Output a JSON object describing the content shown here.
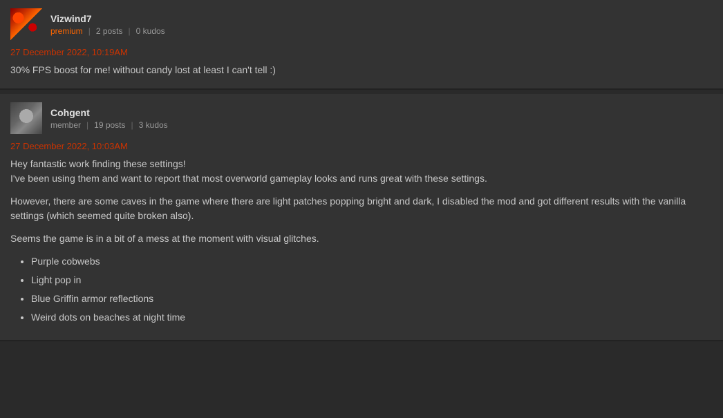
{
  "posts": [
    {
      "id": "post-1",
      "username": "Vizwind7",
      "badge": "premium",
      "badge_type": "premium",
      "posts_count": "2 posts",
      "kudos_count": "0 kudos",
      "timestamp": "27 December 2022, 10:19AM",
      "paragraphs": [
        "30% FPS boost for me! without candy lost at least I can't tell :)"
      ],
      "list_items": []
    },
    {
      "id": "post-2",
      "username": "Cohgent",
      "badge": "member",
      "badge_type": "member",
      "posts_count": "19 posts",
      "kudos_count": "3 kudos",
      "timestamp": "27 December 2022, 10:03AM",
      "paragraphs": [
        "Hey fantastic work finding these settings!\nI've been using them and want to report that most overworld gameplay looks and runs great with these settings.",
        "However, there are some caves in the game where there are light patches popping bright and dark, I disabled the mod and got different results with the vanilla settings (which seemed quite broken also).",
        "Seems the game is in a bit of a mess at the moment with visual glitches."
      ],
      "list_items": [
        "Purple cobwebs",
        "Light pop in",
        "Blue Griffin armor reflections",
        "Weird dots on beaches at night time"
      ]
    }
  ],
  "labels": {
    "posts_separator": "|",
    "kudos_separator": "|"
  }
}
